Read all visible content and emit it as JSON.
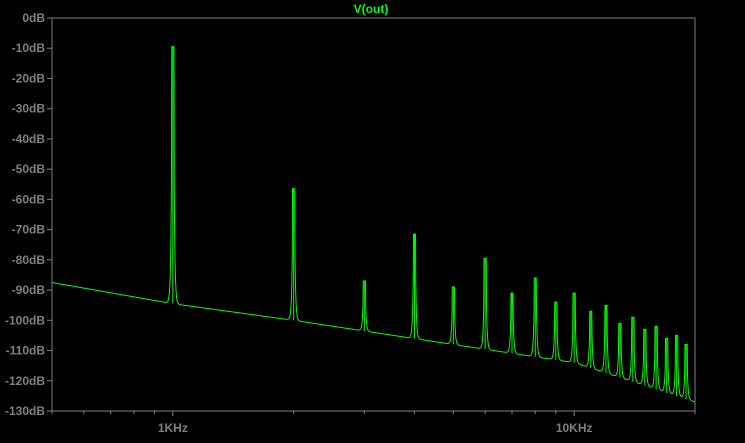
{
  "chart_data": {
    "type": "line",
    "title": "V(out)",
    "xlabel": "",
    "ylabel": "",
    "x_scale": "log",
    "xlim": [
      500,
      20000
    ],
    "ylim": [
      -130,
      0
    ],
    "grid": false,
    "y_ticks": [
      {
        "value": 0,
        "label": "0dB"
      },
      {
        "value": -10,
        "label": "-10dB"
      },
      {
        "value": -20,
        "label": "-20dB"
      },
      {
        "value": -30,
        "label": "-30dB"
      },
      {
        "value": -40,
        "label": "-40dB"
      },
      {
        "value": -50,
        "label": "-50dB"
      },
      {
        "value": -60,
        "label": "-60dB"
      },
      {
        "value": -70,
        "label": "-70dB"
      },
      {
        "value": -80,
        "label": "-80dB"
      },
      {
        "value": -90,
        "label": "-90dB"
      },
      {
        "value": -100,
        "label": "-100dB"
      },
      {
        "value": -110,
        "label": "-110dB"
      },
      {
        "value": -120,
        "label": "-120dB"
      },
      {
        "value": -130,
        "label": "-130dB"
      }
    ],
    "x_ticks": [
      {
        "value": 1000,
        "label": "1KHz"
      },
      {
        "value": 10000,
        "label": "10KHz"
      }
    ],
    "series": [
      {
        "color": "#00ff00",
        "noise_floor": [
          [
            500,
            -87.5
          ],
          [
            1000,
            -94.5
          ],
          [
            2000,
            -100
          ],
          [
            5000,
            -108
          ],
          [
            10000,
            -114
          ],
          [
            20000,
            -127
          ]
        ],
        "harmonics": [
          {
            "f": 1000,
            "db": -9.5
          },
          {
            "f": 2000,
            "db": -56.5
          },
          {
            "f": 3000,
            "db": -87
          },
          {
            "f": 4000,
            "db": -71.5
          },
          {
            "f": 5000,
            "db": -89
          },
          {
            "f": 6000,
            "db": -79.5
          },
          {
            "f": 7000,
            "db": -91
          },
          {
            "f": 8000,
            "db": -86
          },
          {
            "f": 9000,
            "db": -94
          },
          {
            "f": 10000,
            "db": -91
          },
          {
            "f": 11000,
            "db": -97
          },
          {
            "f": 12000,
            "db": -95
          },
          {
            "f": 13000,
            "db": -101
          },
          {
            "f": 14000,
            "db": -99
          },
          {
            "f": 15000,
            "db": -103
          },
          {
            "f": 16000,
            "db": -102
          },
          {
            "f": 17000,
            "db": -106
          },
          {
            "f": 18000,
            "db": -105
          },
          {
            "f": 19000,
            "db": -108
          }
        ]
      }
    ]
  }
}
